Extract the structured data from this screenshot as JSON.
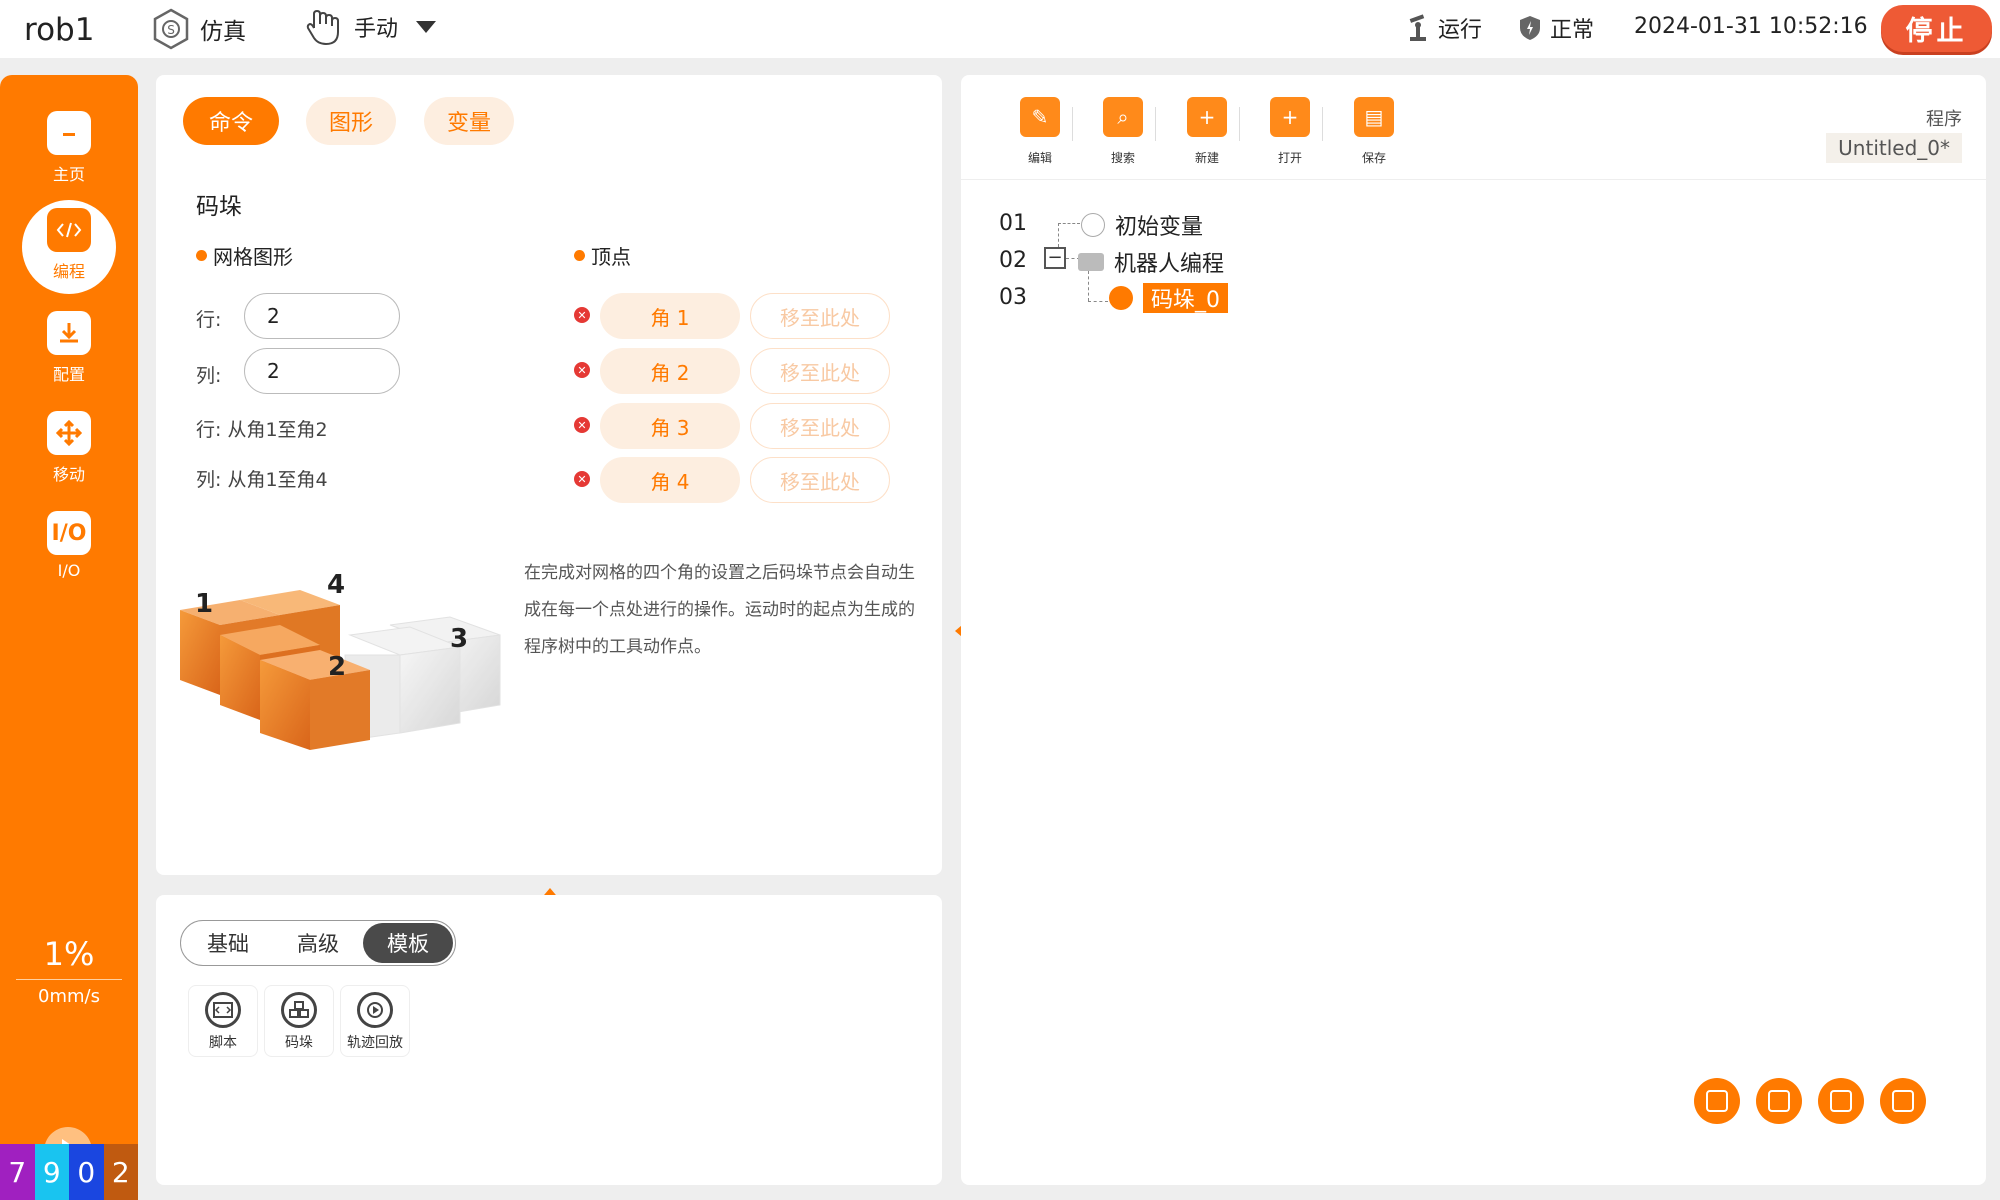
{
  "topbar": {
    "robot_name": "rob1",
    "sim_label": "仿真",
    "manual_label": "手动",
    "run_label": "运行",
    "status_label": "正常",
    "datetime": "2024-01-31 10:52:16",
    "stop_label": "停止"
  },
  "sidebar": {
    "items": [
      {
        "label": "主页",
        "icon": "home-icon"
      },
      {
        "label": "编程",
        "icon": "code-icon"
      },
      {
        "label": "配置",
        "icon": "download-icon"
      },
      {
        "label": "移动",
        "icon": "move-icon"
      },
      {
        "label": "I/O",
        "icon": "io-icon"
      }
    ],
    "speed_percent": "1%",
    "speed_mms": "0mm/s",
    "counter": [
      "7",
      "9",
      "0",
      "2"
    ],
    "counter_colors": [
      "#a020c0",
      "#19c4f0",
      "#1a46e0",
      "#c05a10"
    ]
  },
  "cmd_panel": {
    "tabs": [
      {
        "label": "命令",
        "active": true
      },
      {
        "label": "图形",
        "active": false
      },
      {
        "label": "变量",
        "active": false
      }
    ],
    "title": "码垛",
    "grid_section": "网格图形",
    "vertex_section": "顶点",
    "row_label": "行:",
    "row_value": "2",
    "col_label": "列:",
    "col_value": "2",
    "row_note": "行: 从角1至角2",
    "col_note": "列: 从角1至角4",
    "corners": [
      {
        "label": "角 1",
        "move": "移至此处"
      },
      {
        "label": "角 2",
        "move": "移至此处"
      },
      {
        "label": "角 3",
        "move": "移至此处"
      },
      {
        "label": "角 4",
        "move": "移至此处"
      }
    ],
    "cube_numbers": [
      "1",
      "4",
      "2",
      "3"
    ],
    "description": "在完成对网格的四个角的设置之后码垛节点会自动生成在每一个点处进行的操作。运动时的起点为生成的程序树中的工具动作点。"
  },
  "bottom_panel": {
    "segments": [
      {
        "label": "基础",
        "active": false
      },
      {
        "label": "高级",
        "active": false
      },
      {
        "label": "模板",
        "active": true
      }
    ],
    "tools": [
      {
        "label": "脚本",
        "icon": "script-icon"
      },
      {
        "label": "码垛",
        "icon": "pallet-icon"
      },
      {
        "label": "轨迹回放",
        "icon": "replay-icon"
      }
    ]
  },
  "right_panel": {
    "toolbar": [
      {
        "label": "编辑",
        "icon": "edit-icon"
      },
      {
        "label": "搜索",
        "icon": "search-icon"
      },
      {
        "label": "新建",
        "icon": "new-icon"
      },
      {
        "label": "打开",
        "icon": "open-folder-icon"
      },
      {
        "label": "保存",
        "icon": "save-icon"
      }
    ],
    "program_label": "程序",
    "program_name": "Untitled_0*",
    "tree": [
      {
        "line": "01",
        "label": "初始变量"
      },
      {
        "line": "02",
        "label": "机器人编程"
      },
      {
        "line": "03",
        "label": "码垛_0"
      }
    ],
    "fabs": [
      "tree-expand-icon",
      "tree-collapse-icon",
      "fit-icon",
      "console-icon"
    ]
  },
  "colors": {
    "accent": "#ff7a00",
    "stop": "#ee5a35"
  }
}
